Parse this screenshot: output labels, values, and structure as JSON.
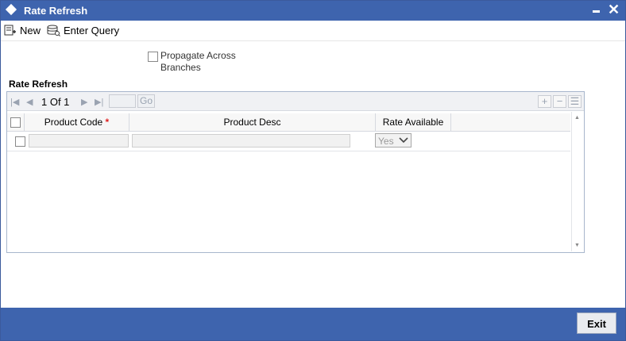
{
  "window": {
    "title": "Rate Refresh"
  },
  "toolbar": {
    "new_label": "New",
    "enter_query_label": "Enter Query"
  },
  "form": {
    "propagate_label": "Propagate Across Branches"
  },
  "section": {
    "title": "Rate Refresh"
  },
  "pager": {
    "page_text": "1 Of 1",
    "go_label": "Go"
  },
  "grid": {
    "columns": {
      "product_code": "Product Code",
      "product_desc": "Product Desc",
      "rate_available": "Rate Available"
    },
    "required_marker": "*",
    "rows": [
      {
        "product_code": "",
        "product_desc": "",
        "rate_available": "Yes"
      }
    ]
  },
  "footer": {
    "exit_label": "Exit"
  },
  "colors": {
    "titlebar": "#3e64ae",
    "footer": "#3e64ae",
    "required": "#e02020"
  }
}
